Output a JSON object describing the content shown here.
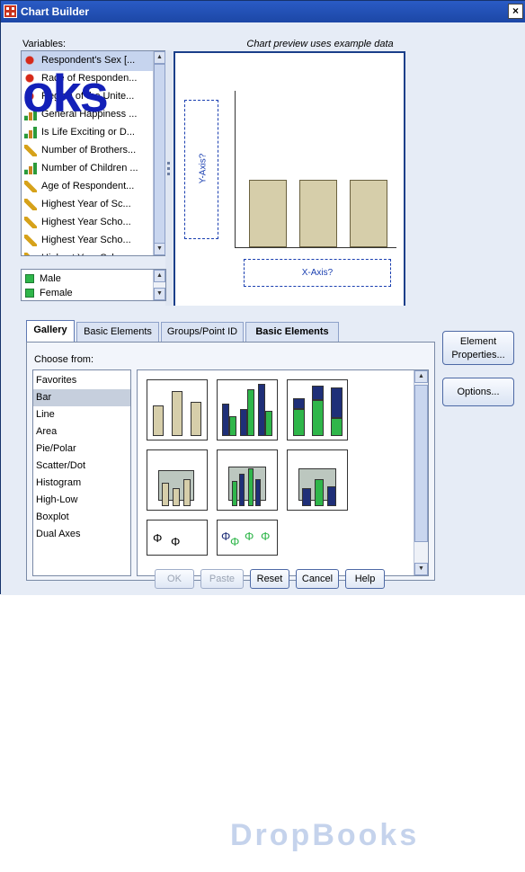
{
  "window": {
    "title": "Chart Builder",
    "close_label": "×"
  },
  "variables": {
    "label": "Variables:",
    "items": [
      {
        "text": "Respondent's Sex [...",
        "icon": "nominal-icon"
      },
      {
        "text": "Race of Responden...",
        "icon": "nominal-icon"
      },
      {
        "text": "Region of the Unite...",
        "icon": "nominal-icon"
      },
      {
        "text": "General Happiness ...",
        "icon": "ordinal-icon"
      },
      {
        "text": "Is Life Exciting or D...",
        "icon": "ordinal-icon"
      },
      {
        "text": "Number of Brothers...",
        "icon": "scale-icon"
      },
      {
        "text": "Number of Children ...",
        "icon": "ordinal-icon"
      },
      {
        "text": "Age of Respondent...",
        "icon": "scale-icon"
      },
      {
        "text": "Highest Year of Sc...",
        "icon": "scale-icon"
      },
      {
        "text": "Highest Year Scho...",
        "icon": "scale-icon"
      },
      {
        "text": "Highest Year Scho...",
        "icon": "scale-icon"
      },
      {
        "text": "Highest Year Scho...",
        "icon": "scale-icon"
      }
    ],
    "categories": [
      "Male",
      "Female"
    ]
  },
  "preview": {
    "caption": "Chart preview uses example data",
    "y_axis_label": "Y-Axis?",
    "x_axis_label": "X-Axis?"
  },
  "chart_data": {
    "type": "bar",
    "categories": [
      "",
      "",
      ""
    ],
    "values": [
      1,
      1,
      1
    ],
    "title": "",
    "xlabel": "X-Axis?",
    "ylabel": "Y-Axis?"
  },
  "tabs": [
    {
      "label": "Gallery",
      "active": true
    },
    {
      "label": "Basic Elements",
      "active": false
    },
    {
      "label": "Groups/Point ID",
      "active": false
    },
    {
      "label": "Basic Elements",
      "active": false,
      "bold": true
    }
  ],
  "gallery": {
    "choose_label": "Choose from:",
    "options": [
      "Favorites",
      "Bar",
      "Line",
      "Area",
      "Pie/Polar",
      "Scatter/Dot",
      "Histogram",
      "High-Low",
      "Boxplot",
      "Dual Axes"
    ],
    "selected": "Bar"
  },
  "side_buttons": {
    "element_properties": "Element Properties...",
    "options": "Options..."
  },
  "actions": {
    "ok": "OK",
    "paste": "Paste",
    "reset": "Reset",
    "cancel": "Cancel",
    "help": "Help"
  },
  "watermark": {
    "text": "oks",
    "logo_text": "DropBooks"
  },
  "colors": {
    "title": "#1c47a6",
    "bar_fill": "#d6ceaa",
    "accent_green": "#2fb64a",
    "accent_navy": "#1f2f78"
  }
}
